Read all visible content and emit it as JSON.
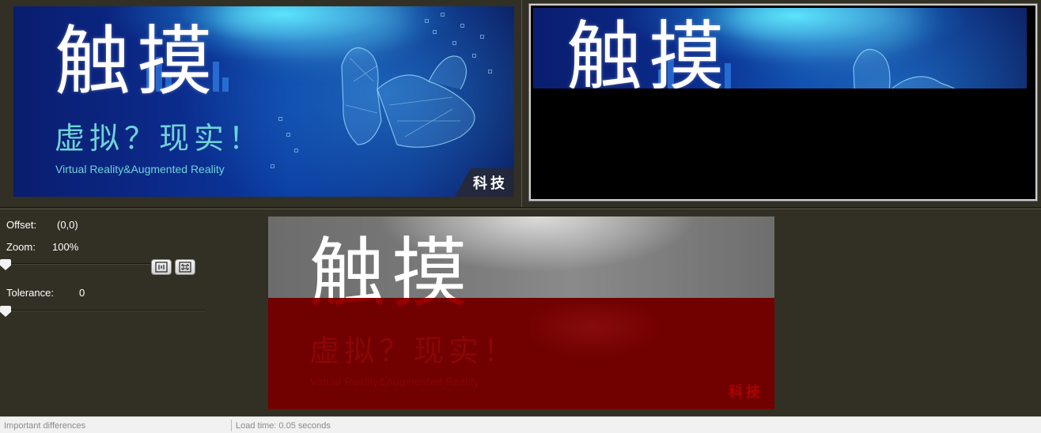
{
  "left_image": {
    "title_cn": "触摸",
    "subtitle_cn": "虚拟？现实！",
    "subtitle_en": "Virtual Reality&Augmented Reality",
    "tag": "科技"
  },
  "right_image": {
    "title_cn": "触摸"
  },
  "diff_image": {
    "title_cn": "触摸",
    "subtitle_cn": "虚拟？现实！",
    "subtitle_en": "Virtual Reality&Augmented Reality",
    "tag": "科技",
    "highlight_color": "#710000"
  },
  "controls": {
    "offset_label": "Offset:",
    "offset_value": "(0,0)",
    "zoom_label": "Zoom:",
    "zoom_value": "100%",
    "tolerance_label": "Tolerance:",
    "tolerance_value": "0",
    "zoom_slider_level": 0,
    "tolerance_slider_level": 0,
    "fit_button_icon": "actual-size-icon",
    "fit_window_icon": "fit-to-window-icon"
  },
  "status_bar": {
    "left_text": "Important differences",
    "right_text": "Load time: 0.05 seconds"
  },
  "colors": {
    "background": "#323024",
    "banner_blue": "#0b2a8a",
    "subtitle_cyan": "#6fd3d8"
  }
}
